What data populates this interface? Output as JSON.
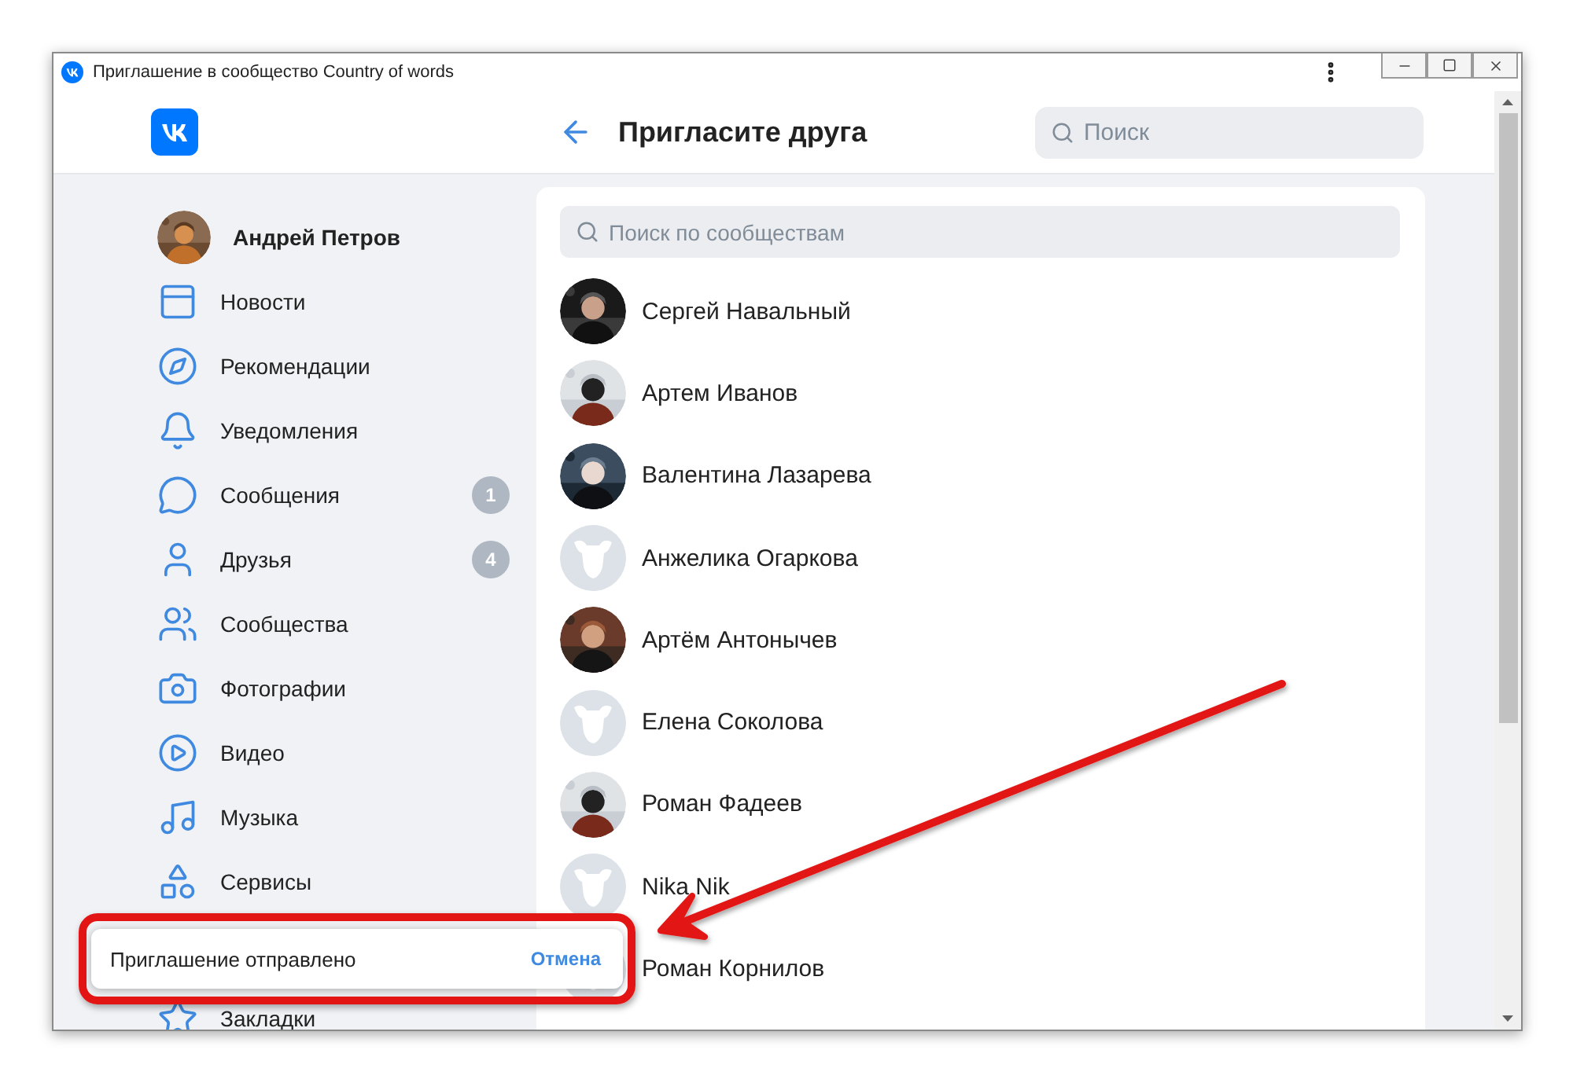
{
  "window": {
    "title": "Приглашение в сообщество Country of words"
  },
  "header": {
    "title": "Пригласите друга",
    "search": {
      "placeholder": "Поиск"
    }
  },
  "profile": {
    "name": "Андрей Петров"
  },
  "nav": [
    {
      "label": "Новости"
    },
    {
      "label": "Рекомендации"
    },
    {
      "label": "Уведомления"
    },
    {
      "label": "Сообщения",
      "badge": "1"
    },
    {
      "label": "Друзья",
      "badge": "4"
    },
    {
      "label": "Сообщества"
    },
    {
      "label": "Фотографии"
    },
    {
      "label": "Видео"
    },
    {
      "label": "Музыка"
    },
    {
      "label": "Сервисы"
    },
    {
      "label": "Закладки"
    }
  ],
  "friends_search": {
    "placeholder": "Поиск по сообществам"
  },
  "friends": [
    {
      "name": "Сергей Навальный"
    },
    {
      "name": "Артем Иванов"
    },
    {
      "name": "Валентина Лазарева"
    },
    {
      "name": "Анжелика Огаркова",
      "kind": "default"
    },
    {
      "name": "Артём Антонычев"
    },
    {
      "name": "Елена Соколова",
      "kind": "default"
    },
    {
      "name": "Роман Фадеев"
    },
    {
      "name": "Nika Nik",
      "kind": "default"
    },
    {
      "name": "Роман Корнилов",
      "kind": "default"
    }
  ],
  "toast": {
    "message": "Приглашение отправлено",
    "action": "Отмена"
  }
}
